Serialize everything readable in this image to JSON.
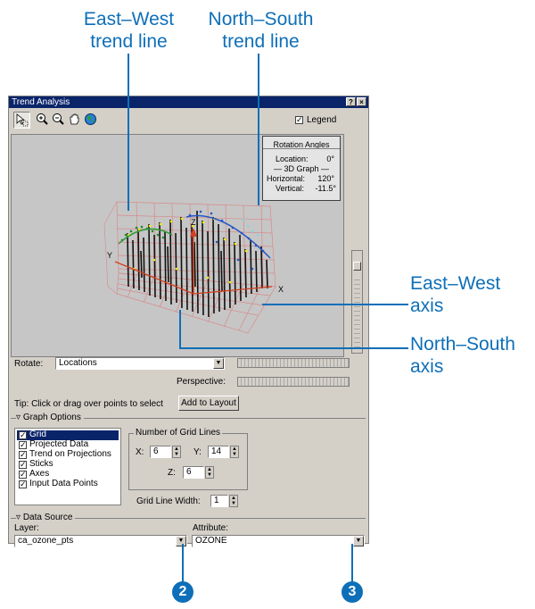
{
  "annotations": {
    "ew_trend": [
      "East–West",
      "trend line"
    ],
    "ns_trend": [
      "North–South",
      "trend line"
    ],
    "ew_axis": [
      "East–West",
      "axis"
    ],
    "ns_axis": [
      "North–South",
      "axis"
    ],
    "badge_layer": "2",
    "badge_attribute": "3"
  },
  "window": {
    "title": "Trend Analysis",
    "help_btn": "?",
    "close_btn": "×",
    "legend_label": "Legend"
  },
  "viewport": {
    "axis_z": "Z",
    "axis_y": "Y",
    "axis_x": "X",
    "rotation_box": {
      "title": "Rotation Angles",
      "location": "Location:",
      "location_val": "0°",
      "graph": "— 3D Graph —",
      "horizontal": "Horizontal:",
      "horizontal_val": "120°",
      "vertical": "Vertical:",
      "vertical_val": "-11.5°"
    }
  },
  "controls": {
    "rotate_label": "Rotate:",
    "rotate_value": "Locations",
    "perspective_label": "Perspective:",
    "tip": "Tip:   Click or drag over points to select",
    "add_to_layout": "Add to Layout"
  },
  "graph_options": {
    "header": "Graph Options",
    "items": [
      "Grid",
      "Projected Data",
      "Trend on Projections",
      "Sticks",
      "Axes",
      "Input Data Points"
    ],
    "grid_lines_title": "Number of Grid Lines",
    "x_label": "X:",
    "x_value": "6",
    "y_label": "Y:",
    "y_value": "14",
    "z_label": "Z:",
    "z_value": "6",
    "line_width_label": "Grid Line Width:",
    "line_width_value": "1"
  },
  "data_source": {
    "header": "Data Source",
    "layer_label": "Layer:",
    "layer_value": "ca_ozone_pts",
    "attribute_label": "Attribute:",
    "attribute_value": "OZONE"
  },
  "colors": {
    "callout": "#0e6fb8",
    "title_bar": "#0a246a",
    "dialog": "#d4d0c8"
  }
}
